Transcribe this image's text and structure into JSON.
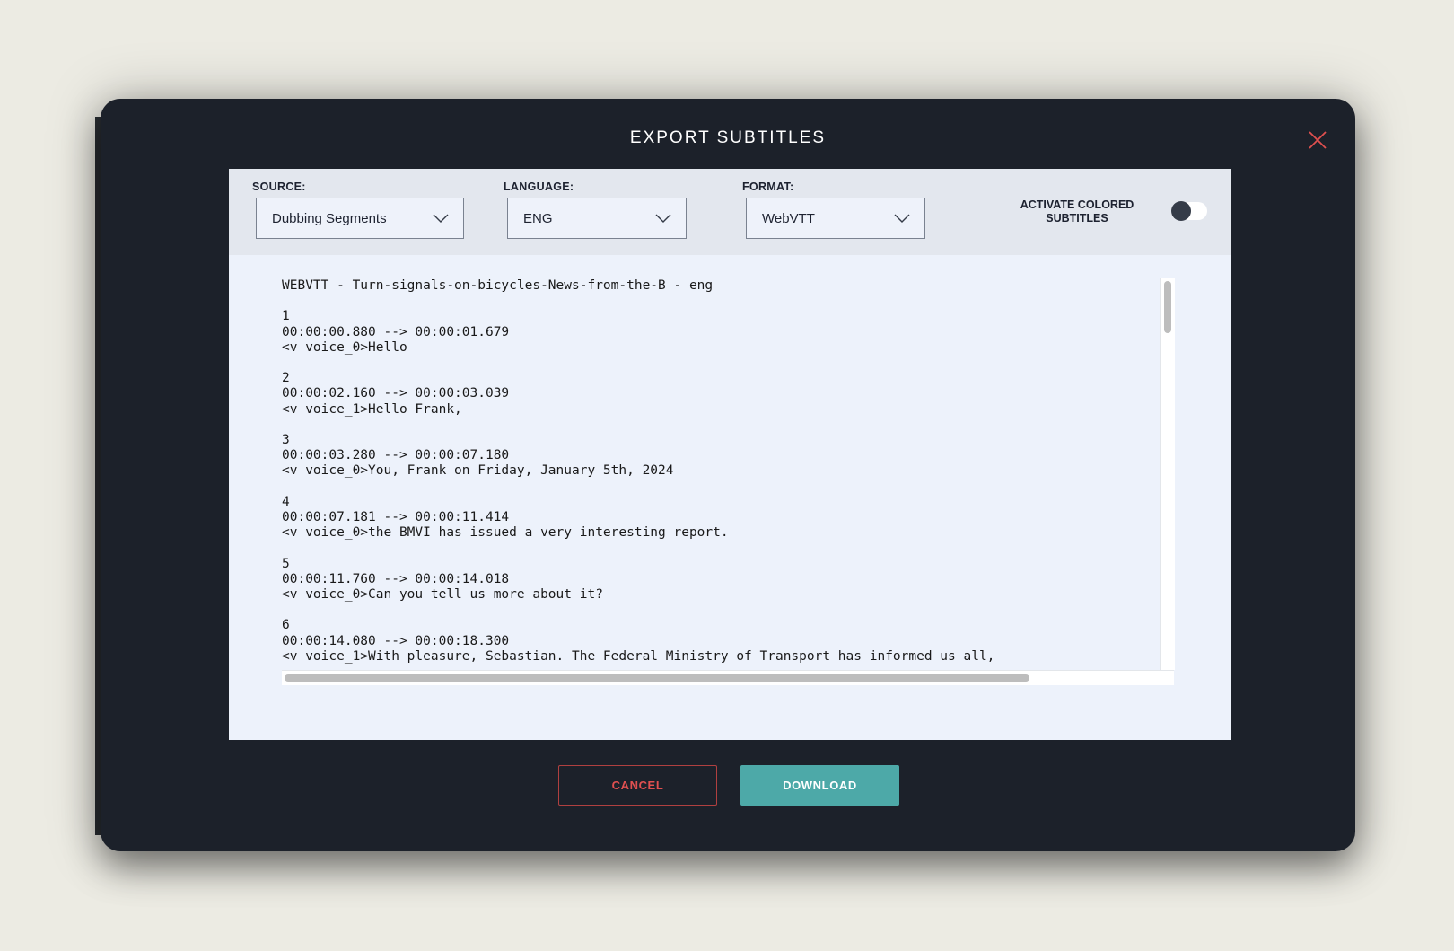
{
  "dialog": {
    "title": "EXPORT SUBTITLES",
    "close_icon": "close-icon"
  },
  "toolbar": {
    "source": {
      "label": "SOURCE:",
      "value": "Dubbing Segments"
    },
    "language": {
      "label": "LANGUAGE:",
      "value": "ENG"
    },
    "format": {
      "label": "FORMAT:",
      "value": "WebVTT"
    },
    "colored_subtitles": {
      "label": "ACTIVATE COLORED SUBTITLES",
      "enabled": false
    }
  },
  "preview": {
    "text": "WEBVTT - Turn-signals-on-bicycles-News-from-the-B - eng\n\n1\n00:00:00.880 --> 00:00:01.679\n<v voice_0>Hello\n\n2\n00:00:02.160 --> 00:00:03.039\n<v voice_1>Hello Frank,\n\n3\n00:00:03.280 --> 00:00:07.180\n<v voice_0>You, Frank on Friday, January 5th, 2024\n\n4\n00:00:07.181 --> 00:00:11.414\n<v voice_0>the BMVI has issued a very interesting report.\n\n5\n00:00:11.760 --> 00:00:14.018\n<v voice_0>Can you tell us more about it?\n\n6\n00:00:14.080 --> 00:00:18.300\n<v voice_1>With pleasure, Sebastian. The Federal Ministry of Transport has informed us all,"
  },
  "actions": {
    "cancel_label": "CANCEL",
    "download_label": "DOWNLOAD"
  },
  "colors": {
    "modal_bg": "#1c212a",
    "panel_bg": "#edf2fb",
    "accent": "#4da9a8",
    "danger": "#e05050"
  }
}
